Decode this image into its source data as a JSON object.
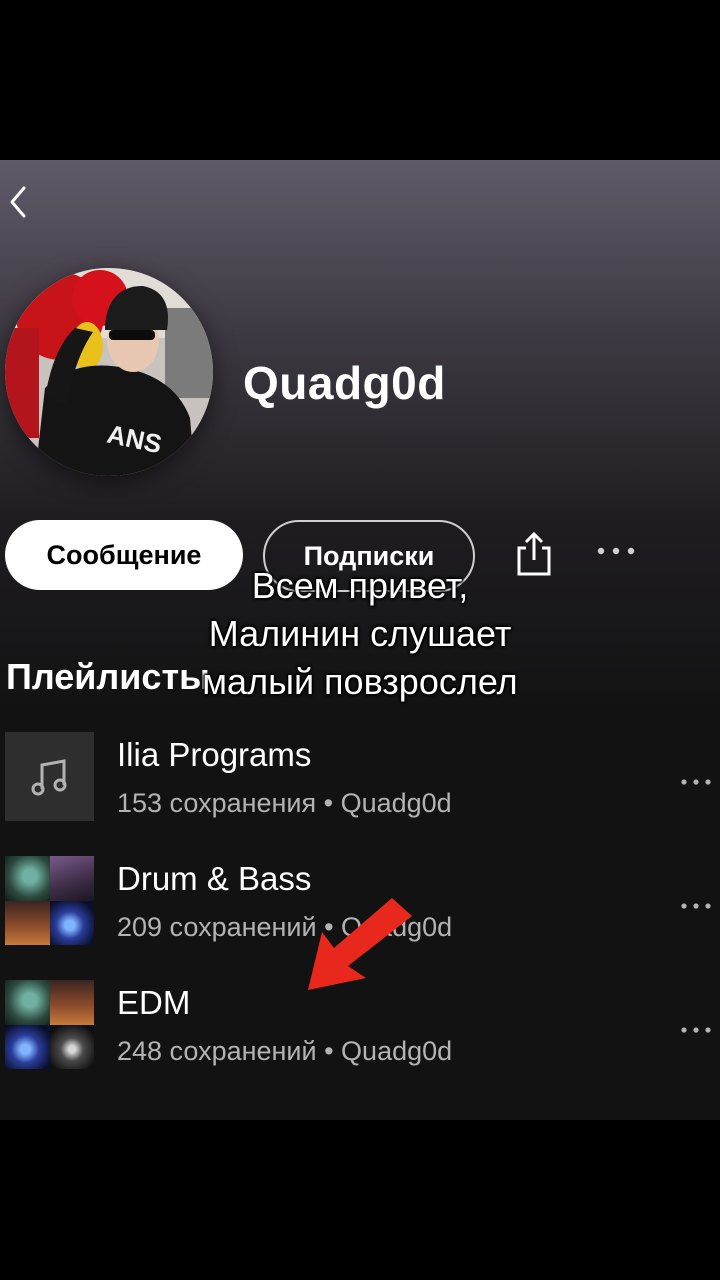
{
  "profile": {
    "name": "Quadg0d"
  },
  "actions": {
    "message_label": "Сообщение",
    "following_label": "Подписки"
  },
  "section": {
    "title": "Плейлисты"
  },
  "caption": {
    "line1": "Всем привет,",
    "line2": "Малинин слушает",
    "line3": "малый повзрослел"
  },
  "playlists": [
    {
      "title": "Ilia Programs",
      "subtitle": "153 сохранения • Quadg0d",
      "cover": "music-note-icon"
    },
    {
      "title": "Drum & Bass",
      "subtitle": "209 сохранений • Quadg0d",
      "cover": "collage"
    },
    {
      "title": "EDM",
      "subtitle": "248 сохранений • Quadg0d",
      "cover": "collage"
    }
  ],
  "icons": {
    "back": "chevron-left-icon",
    "share": "share-icon",
    "more": "more-horizontal-icon",
    "annotation": "red-arrow-icon"
  },
  "colors": {
    "header_gradient_top": "#615a69",
    "background": "#121212",
    "secondary_text": "#b3b3b3",
    "arrow": "#e8281c"
  }
}
